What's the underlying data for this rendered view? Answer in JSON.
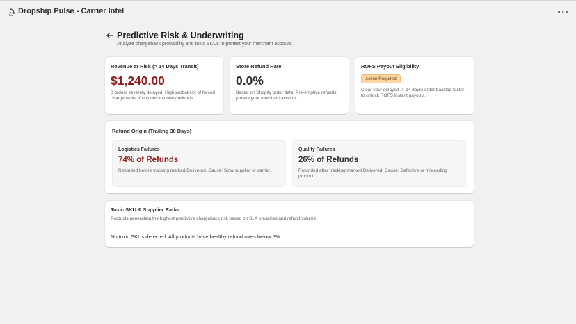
{
  "app": {
    "title": "Dropship Pulse - Carrier Intel",
    "icon": "satellite-dish-icon",
    "more_icon": "ellipsis-icon"
  },
  "page": {
    "title": "Predictive Risk & Underwriting",
    "subtitle": "Analyze chargeback probability and toxic SKUs to protect your merchant account.",
    "back_icon": "arrow-left-icon"
  },
  "metrics": {
    "revenue_at_risk": {
      "heading": "Revenue at Risk (> 14 Days Transit)",
      "value": "$1,240.00",
      "description": "0 orders severely delayed. High probability of forced chargebacks. Consider voluntary refunds.",
      "value_color": "#8e1f1f"
    },
    "refund_rate": {
      "heading": "Store Refund Rate",
      "value": "0.0%",
      "description": "Based on Shopify order data. Pre-emptive refunds protect your merchant account.",
      "value_color": "#303030"
    },
    "rofs": {
      "heading": "ROFS Payout Eligibility",
      "badge": "Action Required",
      "description": "Clear your delayed (> 14 days) order backlog faster to unlock ROFS instant payouts."
    }
  },
  "refund_origin": {
    "heading": "Refund Origin (Trailing 30 Days)",
    "logistics": {
      "heading": "Logistics Failures",
      "value": "74% of Refunds",
      "description": "Refunded before tracking marked Delivered. Cause: Slow supplier or carrier.",
      "value_color": "#8e1f1f"
    },
    "quality": {
      "heading": "Quality Failures",
      "value": "26% of Refunds",
      "description": "Refunded after tracking marked Delivered. Cause: Defective or misleading product.",
      "value_color": "#303030"
    }
  },
  "toxic_sku": {
    "heading": "Toxic SKU & Supplier Radar",
    "subheading": "Products generating the highest predictive chargeback risk based on SLA breaches and refund volume.",
    "empty_message": "No toxic SKUs detected. All products have healthy refund rates below 5%."
  }
}
